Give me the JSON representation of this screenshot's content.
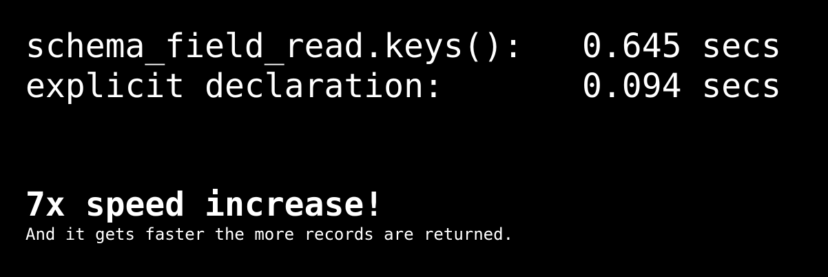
{
  "timings": [
    {
      "label": "schema_field_read.keys():",
      "value": "0.645 secs"
    },
    {
      "label": "explicit declaration:",
      "value": "0.094 secs"
    }
  ],
  "headline": "7x speed increase!",
  "subline": "And it gets faster the more records are returned.",
  "colors": {
    "background": "#000000",
    "text": "#ffffff"
  }
}
